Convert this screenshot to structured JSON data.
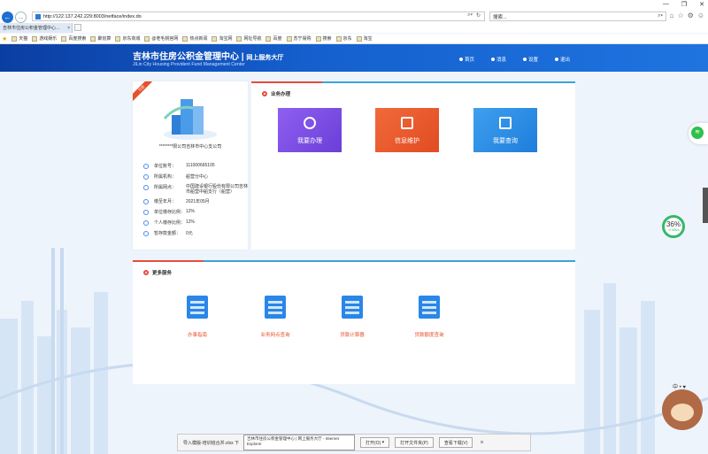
{
  "browser": {
    "url": "http://122.137.242.229:8003/netface/index.do",
    "search_placeholder": "搜索...",
    "tab_title": "吉林市住房公积金管理中心...",
    "favorites": [
      "天猫",
      "游戏娱乐",
      "百度搜索",
      "聚划算",
      "京东商城",
      "@老毛桃官网",
      "热点新闻",
      "淘宝网",
      "网址导航",
      "百度",
      "苏宁易购",
      "搜索",
      "京东",
      "淘宝"
    ]
  },
  "header": {
    "logo_cn": "吉林市住房公积金管理中心",
    "logo_sub": "网上服务大厅",
    "logo_en": "JiLin City Housing Provident Fund Management Center",
    "nav": [
      "首页",
      "消息",
      "设置",
      "退出"
    ]
  },
  "profile": {
    "ribbon": "已登",
    "org_name": "********限公司吉林市中心支公司",
    "rows": [
      {
        "label": "单位账号：",
        "value": "111000665105"
      },
      {
        "label": "所属机构：",
        "value": "船营分中心"
      },
      {
        "label": "所属网点：",
        "value": "中国建设银行股份有限公司吉林市船营中船支行（船营）"
      },
      {
        "label": "缴至年月：",
        "value": "2021年05月"
      },
      {
        "label": "单位缴存比例：",
        "value": "12%"
      },
      {
        "label": "个人缴存比例：",
        "value": "12%"
      },
      {
        "label": "暂存款金额：",
        "value": "0元"
      }
    ]
  },
  "business": {
    "title": "业务办理",
    "tiles": [
      "我要办理",
      "信息维护",
      "我要查询"
    ]
  },
  "more": {
    "title": "更多服务",
    "services": [
      "办事指南",
      "业务网点查询",
      "贷款计算器",
      "贷款额度查询"
    ]
  },
  "widgets": {
    "gauge_pct": "36%",
    "gauge_speed": "↑0.08K/s",
    "bear_label": "中 • ♥"
  },
  "download": {
    "file": "导入模版-培训班合并.xlsx 下",
    "tip": "吉林市住房公积金管理中心 | 网上服务大厅 - Internet Explorer",
    "open": "打开(O)",
    "open_folder": "打开文件夹(P)",
    "view": "查看下载(V)"
  }
}
